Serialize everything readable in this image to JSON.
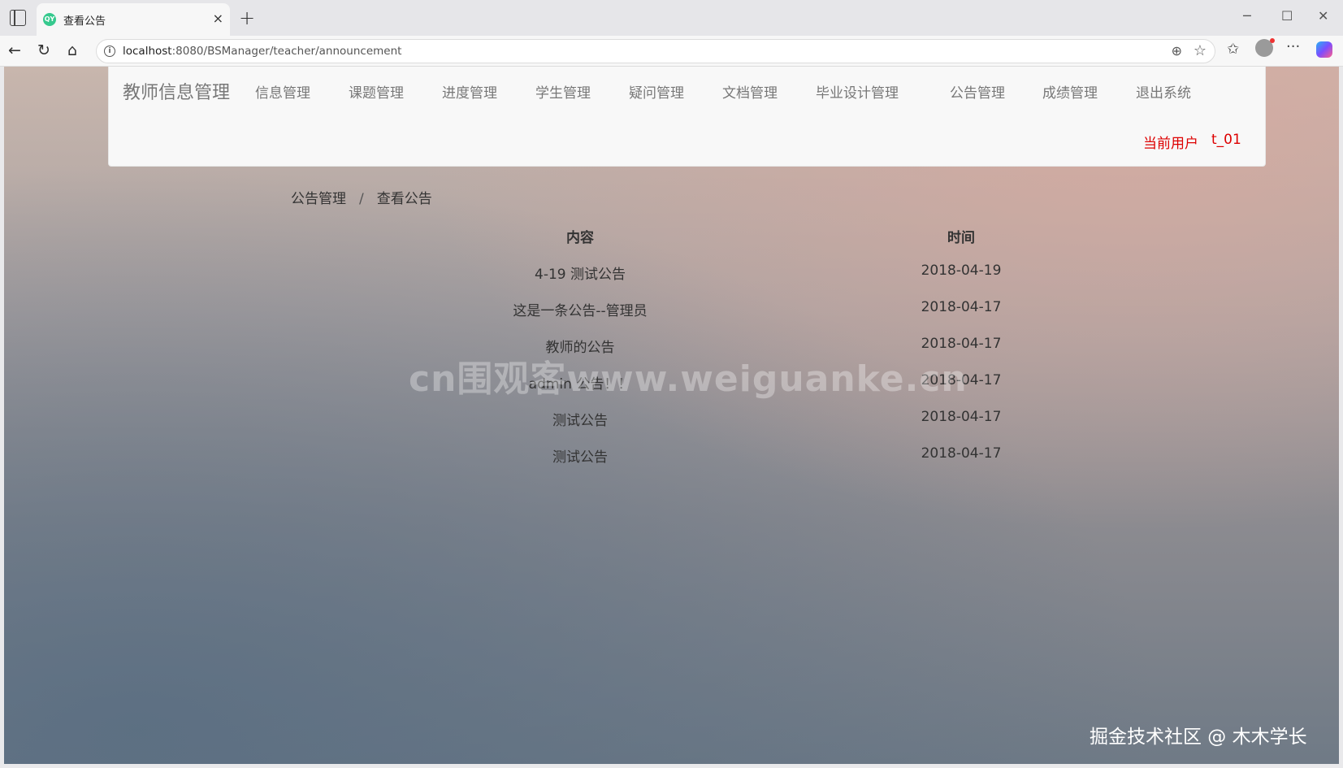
{
  "browser": {
    "tab_title": "查看公告",
    "favicon_text": "QY",
    "url_host": "localhost",
    "url_rest": ":8080/BSManager/teacher/announcement"
  },
  "icons": {
    "sidebar_toggle": "sidebar-toggle-icon",
    "close": "close-icon",
    "new_tab": "plus-icon",
    "minimize": "minimize-icon",
    "maximize": "maximize-icon",
    "window_close": "window-close-icon",
    "back": "back-arrow-icon",
    "reload": "reload-icon",
    "home": "home-icon",
    "info": "info-icon",
    "zoom": "zoom-icon",
    "favorite": "star-icon",
    "favorites": "favorites-icon",
    "profile": "profile-icon",
    "more": "more-icon",
    "copilot": "copilot-icon"
  },
  "navbar": {
    "brand": "教师信息管理",
    "items": [
      "信息管理",
      "课题管理",
      "进度管理",
      "学生管理",
      "疑问管理",
      "文档管理",
      "毕业设计管理",
      "公告管理",
      "成绩管理",
      "退出系统"
    ],
    "current_user_label": "当前用户",
    "current_user": "t_01"
  },
  "breadcrumb": {
    "parent": "公告管理",
    "separator": "/",
    "current": "查看公告"
  },
  "table": {
    "headers": [
      "内容",
      "时间"
    ],
    "rows": [
      [
        "4-19 测试公告",
        "2018-04-19"
      ],
      [
        "这是一条公告--管理员",
        "2018-04-17"
      ],
      [
        "教师的公告",
        "2018-04-17"
      ],
      [
        "admin 公告！！",
        "2018-04-17"
      ],
      [
        "测试公告",
        "2018-04-17"
      ],
      [
        "测试公告",
        "2018-04-17"
      ]
    ]
  },
  "watermark": "cn围观客www.weiguanke.cn",
  "credit": "掘金技术社区 @ 木木学长",
  "colors": {
    "accent_user": "#dd0000",
    "navbar_bg": "#f8f8f8"
  }
}
